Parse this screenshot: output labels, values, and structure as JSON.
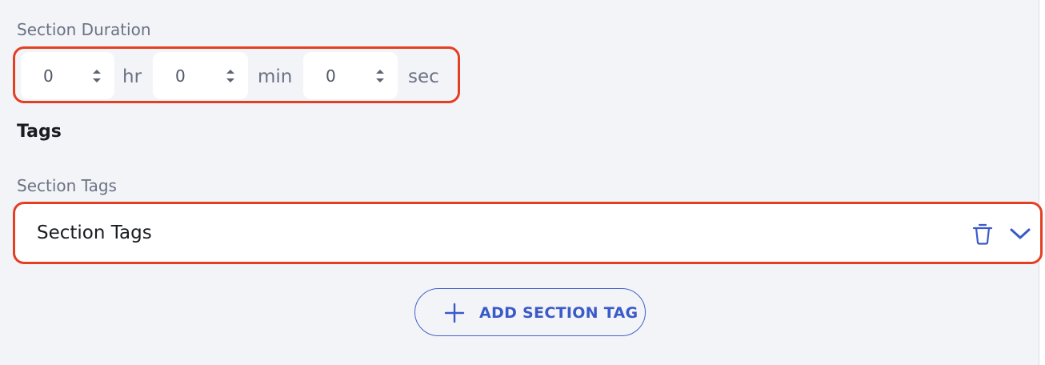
{
  "duration": {
    "label": "Section Duration",
    "hours": {
      "value": "0",
      "unit": "hr"
    },
    "minutes": {
      "value": "0",
      "unit": "min"
    },
    "seconds": {
      "value": "0",
      "unit": "sec"
    }
  },
  "tags": {
    "heading": "Tags",
    "field_label": "Section Tags",
    "select_value": "Section Tags",
    "add_button_label": "ADD SECTION TAG"
  },
  "colors": {
    "accent": "#3a5bc7",
    "highlight": "#e43f23",
    "background": "#f3f4f8"
  }
}
